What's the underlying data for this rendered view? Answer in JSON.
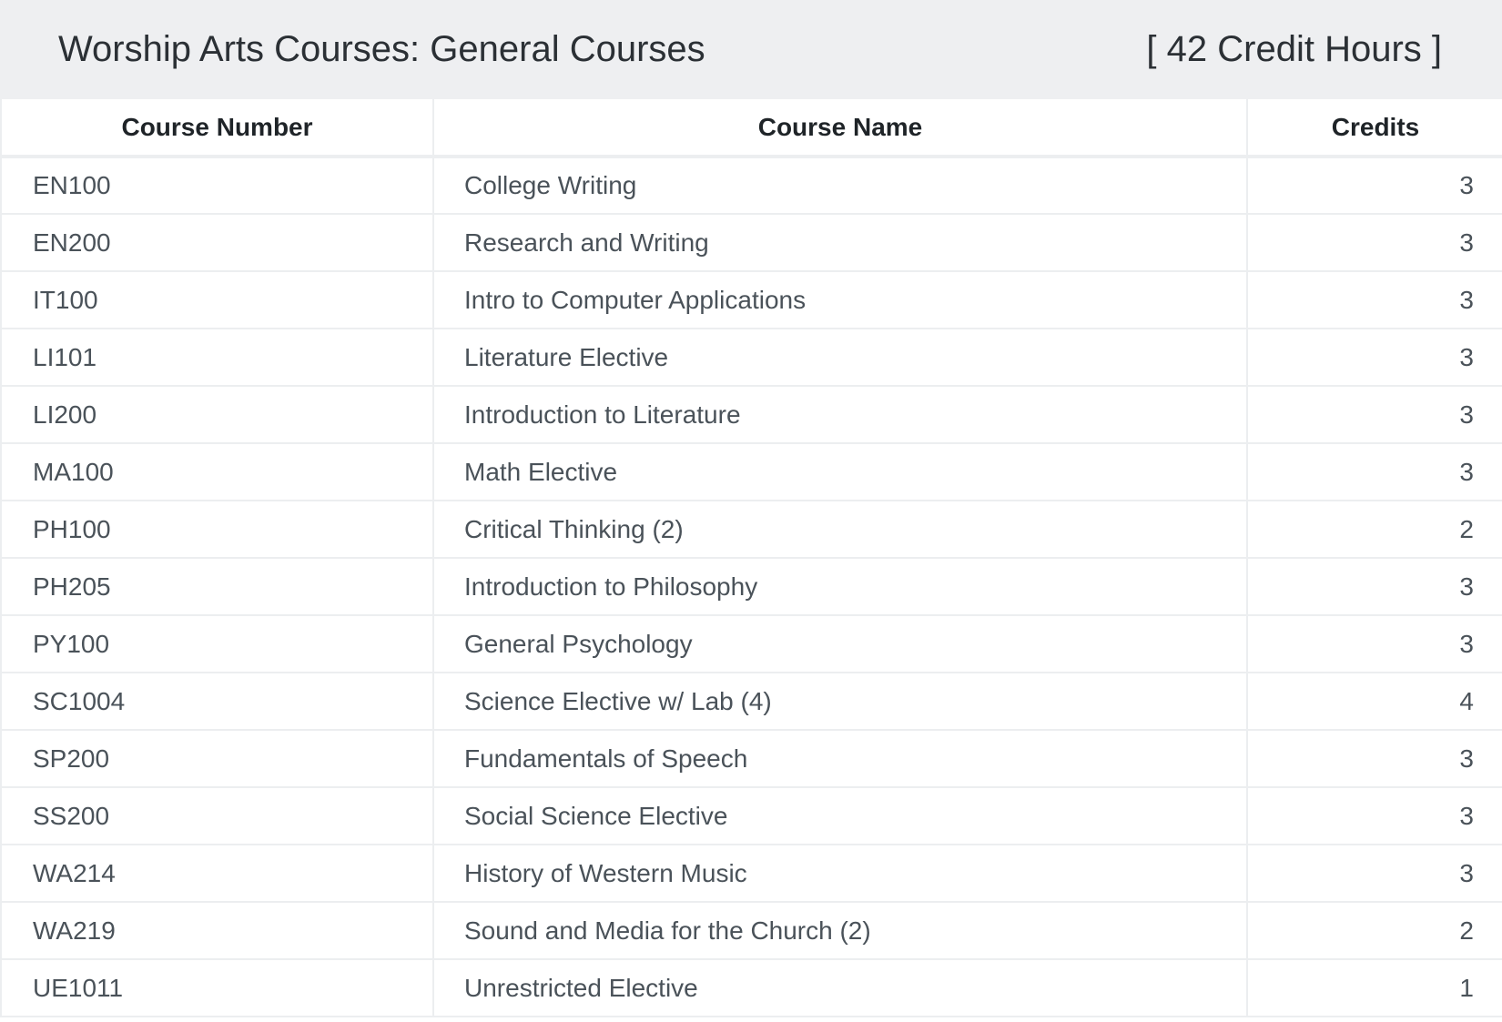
{
  "header": {
    "title": "Worship Arts Courses: General Courses",
    "credit_hours": "[ 42 Credit Hours ]"
  },
  "table": {
    "columns": [
      "Course Number",
      "Course Name",
      "Credits"
    ],
    "rows": [
      {
        "number": "EN100",
        "name": "College Writing",
        "credits": "3"
      },
      {
        "number": "EN200",
        "name": "Research and Writing",
        "credits": "3"
      },
      {
        "number": "IT100",
        "name": "Intro to Computer Applications",
        "credits": "3"
      },
      {
        "number": "LI101",
        "name": "Literature Elective",
        "credits": "3"
      },
      {
        "number": "LI200",
        "name": "Introduction to Literature",
        "credits": "3"
      },
      {
        "number": "MA100",
        "name": "Math Elective",
        "credits": "3"
      },
      {
        "number": "PH100",
        "name": "Critical Thinking (2)",
        "credits": "2"
      },
      {
        "number": "PH205",
        "name": "Introduction to Philosophy",
        "credits": "3"
      },
      {
        "number": "PY100",
        "name": "General Psychology",
        "credits": "3"
      },
      {
        "number": "SC1004",
        "name": "Science Elective w/ Lab (4)",
        "credits": "4"
      },
      {
        "number": "SP200",
        "name": "Fundamentals of Speech",
        "credits": "3"
      },
      {
        "number": "SS200",
        "name": "Social Science Elective",
        "credits": "3"
      },
      {
        "number": "WA214",
        "name": "History of Western Music",
        "credits": "3"
      },
      {
        "number": "WA219",
        "name": "Sound and Media for the Church (2)",
        "credits": "2"
      },
      {
        "number": "UE1011",
        "name": "Unrestricted Elective",
        "credits": "1"
      }
    ]
  }
}
